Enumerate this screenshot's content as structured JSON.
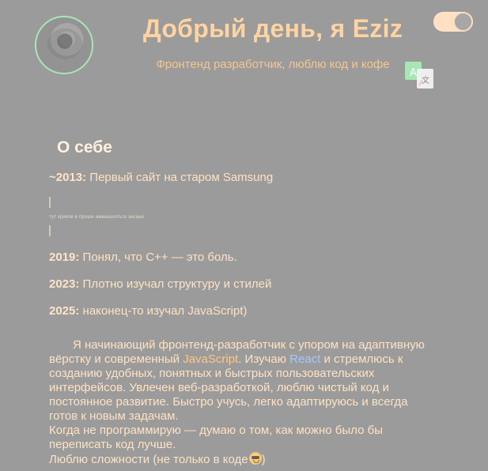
{
  "header": {
    "title": "Добрый день, я Eziz",
    "subtitle": "Фронтенд разработчик, люблю код и кофе",
    "avatar_alt": "",
    "toggle": {
      "state": "on"
    },
    "translate": {
      "primary": "A",
      "secondary": "文"
    }
  },
  "about": {
    "title": "О себе",
    "timeline": [
      {
        "year": "~2013:",
        "text": "Первый сайт на старом Samsung"
      },
      {
        "note": "тут криков в проше аммашхотьте ангане"
      },
      {
        "year": "2019:",
        "text": "Понял, что C++ — это боль."
      },
      {
        "year": "2023:",
        "text": "Плотно изучал структуру и стилей"
      },
      {
        "year": "2025:",
        "text": "наконец-то изучал JavaScript)"
      }
    ],
    "bio": {
      "p1_start": "Я начинающий фронтенд-разработчик с упором на адаптивную вёрстку и современный ",
      "js": "JavaScript",
      "p1_mid": ". Изучаю ",
      "react": "React",
      "p1_end": " и стремлюсь к созданию удобных, понятных и быстрых пользовательских интерфейсов. Увлечен веб-разработкой, люблю чистый код и постоянное развитие. Быстро учусь, легко адаптируюсь и всегда готов к новым задачам.",
      "p2": "Когда не программирую — думаю о том, как можно было бы переписать код лучше.",
      "p3_start": "Люблю сложности (не только в коде",
      "p3_end": ")"
    }
  },
  "colors": {
    "background": "#9b9b9b",
    "peach": "#ffd3a2",
    "green": "#a9e6b6",
    "blue": "#a7c8ff"
  },
  "icons": {
    "translate": "translate-icon",
    "emoji": "cool-face-emoji-icon"
  }
}
